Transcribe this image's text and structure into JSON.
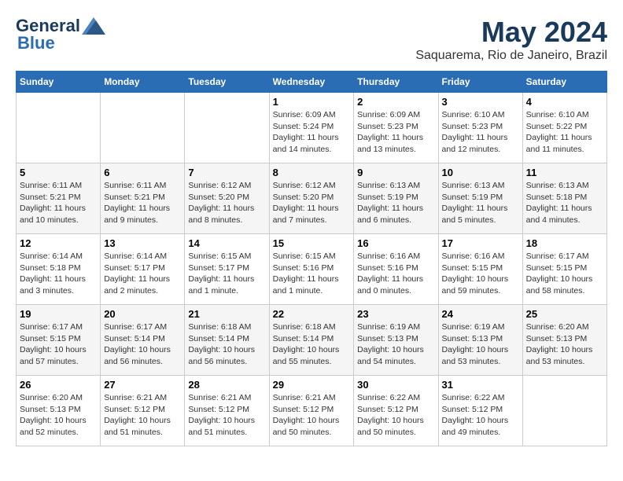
{
  "logo": {
    "general": "General",
    "blue": "Blue"
  },
  "title": "May 2024",
  "location": "Saquarema, Rio de Janeiro, Brazil",
  "weekdays": [
    "Sunday",
    "Monday",
    "Tuesday",
    "Wednesday",
    "Thursday",
    "Friday",
    "Saturday"
  ],
  "weeks": [
    [
      {
        "day": "",
        "info": ""
      },
      {
        "day": "",
        "info": ""
      },
      {
        "day": "",
        "info": ""
      },
      {
        "day": "1",
        "info": "Sunrise: 6:09 AM\nSunset: 5:24 PM\nDaylight: 11 hours\nand 14 minutes."
      },
      {
        "day": "2",
        "info": "Sunrise: 6:09 AM\nSunset: 5:23 PM\nDaylight: 11 hours\nand 13 minutes."
      },
      {
        "day": "3",
        "info": "Sunrise: 6:10 AM\nSunset: 5:23 PM\nDaylight: 11 hours\nand 12 minutes."
      },
      {
        "day": "4",
        "info": "Sunrise: 6:10 AM\nSunset: 5:22 PM\nDaylight: 11 hours\nand 11 minutes."
      }
    ],
    [
      {
        "day": "5",
        "info": "Sunrise: 6:11 AM\nSunset: 5:21 PM\nDaylight: 11 hours\nand 10 minutes."
      },
      {
        "day": "6",
        "info": "Sunrise: 6:11 AM\nSunset: 5:21 PM\nDaylight: 11 hours\nand 9 minutes."
      },
      {
        "day": "7",
        "info": "Sunrise: 6:12 AM\nSunset: 5:20 PM\nDaylight: 11 hours\nand 8 minutes."
      },
      {
        "day": "8",
        "info": "Sunrise: 6:12 AM\nSunset: 5:20 PM\nDaylight: 11 hours\nand 7 minutes."
      },
      {
        "day": "9",
        "info": "Sunrise: 6:13 AM\nSunset: 5:19 PM\nDaylight: 11 hours\nand 6 minutes."
      },
      {
        "day": "10",
        "info": "Sunrise: 6:13 AM\nSunset: 5:19 PM\nDaylight: 11 hours\nand 5 minutes."
      },
      {
        "day": "11",
        "info": "Sunrise: 6:13 AM\nSunset: 5:18 PM\nDaylight: 11 hours\nand 4 minutes."
      }
    ],
    [
      {
        "day": "12",
        "info": "Sunrise: 6:14 AM\nSunset: 5:18 PM\nDaylight: 11 hours\nand 3 minutes."
      },
      {
        "day": "13",
        "info": "Sunrise: 6:14 AM\nSunset: 5:17 PM\nDaylight: 11 hours\nand 2 minutes."
      },
      {
        "day": "14",
        "info": "Sunrise: 6:15 AM\nSunset: 5:17 PM\nDaylight: 11 hours\nand 1 minute."
      },
      {
        "day": "15",
        "info": "Sunrise: 6:15 AM\nSunset: 5:16 PM\nDaylight: 11 hours\nand 1 minute."
      },
      {
        "day": "16",
        "info": "Sunrise: 6:16 AM\nSunset: 5:16 PM\nDaylight: 11 hours\nand 0 minutes."
      },
      {
        "day": "17",
        "info": "Sunrise: 6:16 AM\nSunset: 5:15 PM\nDaylight: 10 hours\nand 59 minutes."
      },
      {
        "day": "18",
        "info": "Sunrise: 6:17 AM\nSunset: 5:15 PM\nDaylight: 10 hours\nand 58 minutes."
      }
    ],
    [
      {
        "day": "19",
        "info": "Sunrise: 6:17 AM\nSunset: 5:15 PM\nDaylight: 10 hours\nand 57 minutes."
      },
      {
        "day": "20",
        "info": "Sunrise: 6:17 AM\nSunset: 5:14 PM\nDaylight: 10 hours\nand 56 minutes."
      },
      {
        "day": "21",
        "info": "Sunrise: 6:18 AM\nSunset: 5:14 PM\nDaylight: 10 hours\nand 56 minutes."
      },
      {
        "day": "22",
        "info": "Sunrise: 6:18 AM\nSunset: 5:14 PM\nDaylight: 10 hours\nand 55 minutes."
      },
      {
        "day": "23",
        "info": "Sunrise: 6:19 AM\nSunset: 5:13 PM\nDaylight: 10 hours\nand 54 minutes."
      },
      {
        "day": "24",
        "info": "Sunrise: 6:19 AM\nSunset: 5:13 PM\nDaylight: 10 hours\nand 53 minutes."
      },
      {
        "day": "25",
        "info": "Sunrise: 6:20 AM\nSunset: 5:13 PM\nDaylight: 10 hours\nand 53 minutes."
      }
    ],
    [
      {
        "day": "26",
        "info": "Sunrise: 6:20 AM\nSunset: 5:13 PM\nDaylight: 10 hours\nand 52 minutes."
      },
      {
        "day": "27",
        "info": "Sunrise: 6:21 AM\nSunset: 5:12 PM\nDaylight: 10 hours\nand 51 minutes."
      },
      {
        "day": "28",
        "info": "Sunrise: 6:21 AM\nSunset: 5:12 PM\nDaylight: 10 hours\nand 51 minutes."
      },
      {
        "day": "29",
        "info": "Sunrise: 6:21 AM\nSunset: 5:12 PM\nDaylight: 10 hours\nand 50 minutes."
      },
      {
        "day": "30",
        "info": "Sunrise: 6:22 AM\nSunset: 5:12 PM\nDaylight: 10 hours\nand 50 minutes."
      },
      {
        "day": "31",
        "info": "Sunrise: 6:22 AM\nSunset: 5:12 PM\nDaylight: 10 hours\nand 49 minutes."
      },
      {
        "day": "",
        "info": ""
      }
    ]
  ]
}
